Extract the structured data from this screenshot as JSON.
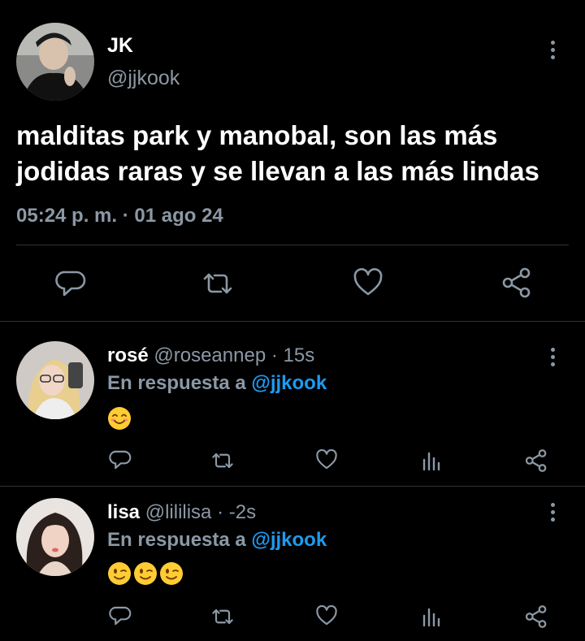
{
  "main_tweet": {
    "author_name": "JK",
    "author_handle": "@jjkook",
    "text": "malditas park y manobal, son las más jodidas raras y se llevan a las más lindas",
    "timestamp": "05:24 p. m. · 01 ago 24",
    "actions": [
      "reply-icon",
      "retweet-icon",
      "like-icon",
      "share-icon"
    ]
  },
  "replies": [
    {
      "name": "rosé",
      "handle": "@roseannep",
      "time": "· 15s",
      "replying_prefix": "En respuesta a ",
      "replying_to": "@jjkook",
      "emojis": [
        "smiling-face-emoji"
      ]
    },
    {
      "name": "lisa",
      "handle": "@lililisa",
      "time": "· -2s",
      "replying_prefix": "En respuesta a ",
      "replying_to": "@jjkook",
      "emojis": [
        "winking-face-emoji",
        "winking-face-emoji",
        "winking-face-emoji"
      ]
    }
  ],
  "colors": {
    "background": "#000000",
    "text": "#ffffff",
    "secondary": "#8b98a5",
    "accent": "#1d9bf0",
    "divider": "#2f3336",
    "emoji": "#ffcc33"
  }
}
